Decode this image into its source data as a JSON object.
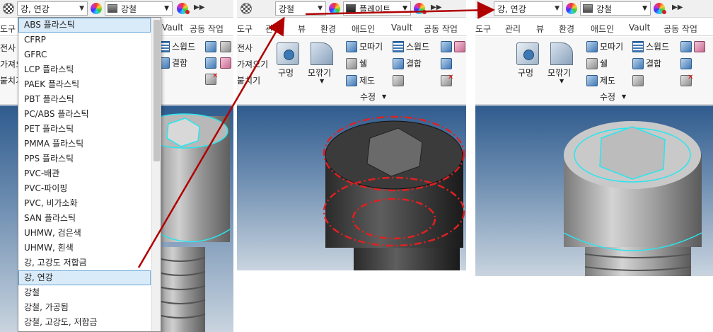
{
  "panel1": {
    "material_value": "강, 연강",
    "appearance_value": "강철",
    "tabs": [
      "도구",
      "Vault",
      "공동 작업"
    ],
    "ribbon_left_labels": [
      "전사",
      "가져오기",
      "붙치기"
    ],
    "ribbon_right": {
      "sweep": "스윕드",
      "join": "결합"
    },
    "dropdown_items": [
      "ABS 플라스틱",
      "CFRP",
      "GFRC",
      "LCP 플라스틱",
      "PAEK 플라스틱",
      "PBT 플라스틱",
      "PC/ABS 플라스틱",
      "PET 플라스틱",
      "PMMA 플라스틱",
      "PPS 플라스틱",
      "PVC-배관",
      "PVC-파이핑",
      "PVC, 비가소화",
      "SAN 플라스틱",
      "UHMW, 검은색",
      "UHMW, 흰색",
      "강, 고강도 저합금",
      "강, 연강",
      "강철",
      "강철, 가공됨",
      "강철, 고강도, 저합금"
    ]
  },
  "panel2": {
    "material_value": "강철",
    "appearance_value": "플레이트",
    "tabs": [
      "도구",
      "관리",
      "뷰",
      "환경",
      "애드인",
      "Vault",
      "공동 작업"
    ],
    "ribbon": {
      "hole": "구멍",
      "fillet": "모깎기",
      "chamfer": "모따기",
      "shell": "쉘",
      "draft": "제도",
      "sweep": "스윕드",
      "join": "결합",
      "group": "수정"
    },
    "left_labels": [
      "전사",
      "가져오기",
      "붙치기"
    ]
  },
  "panel3": {
    "material_value": "강, 연강",
    "appearance_value": "강철",
    "tabs": [
      "도구",
      "관리",
      "뷰",
      "환경",
      "애드인",
      "Vault",
      "공동 작업"
    ],
    "ribbon": {
      "hole": "구멍",
      "fillet": "모깎기",
      "chamfer": "모따기",
      "shell": "쉘",
      "draft": "제도",
      "sweep": "스윕드",
      "join": "결합",
      "group": "수정"
    }
  },
  "colors": {
    "arrow": "#b00000",
    "highlight": "#d9ebf9",
    "viewport_top": "#2f5b8e",
    "edge_cyan": "#29e6ee"
  },
  "icons": [
    "checker-icon",
    "color-wheel-icon",
    "appearance-swatch-icon",
    "overflow-icon",
    "hole-icon",
    "fillet-icon"
  ]
}
